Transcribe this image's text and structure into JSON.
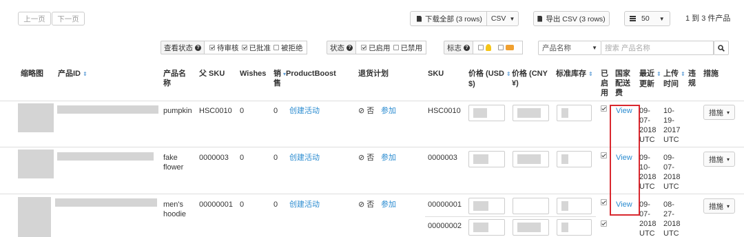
{
  "toolbar": {
    "prev_label": "上一页",
    "next_label": "下一页",
    "download_label": "下载全部 (3 rows)",
    "download_format": "CSV",
    "export_label": "导出 CSV (3 rows)",
    "page_size": "50",
    "range_text": "1 到 3 件产品"
  },
  "filters": {
    "review_status_label": "查看状态",
    "review_options": [
      {
        "label": "待审核",
        "checked": true
      },
      {
        "label": "已批准",
        "checked": true
      },
      {
        "label": "被拒绝",
        "checked": false
      }
    ],
    "status_label": "状态",
    "status_options": [
      {
        "label": "已启用",
        "checked": true
      },
      {
        "label": "已禁用",
        "checked": false
      }
    ],
    "tag_label": "标志",
    "search_field": "产品名称",
    "search_placeholder": "搜索 产品名称"
  },
  "table": {
    "headers": {
      "thumb": "缩略图",
      "product_id": "产品ID",
      "name_1": "产品名",
      "name_2": "称",
      "parent_sku": "父 SKU",
      "wishes": "Wishes",
      "sales_1": "销",
      "sales_2": "售",
      "productboost": "ProductBoost",
      "return_plan": "退货计划",
      "sku": "SKU",
      "price_usd_1": "价格 (USD",
      "price_usd_2": "$)",
      "price_cny_1": "价格 (CNY",
      "price_cny_2": "¥)",
      "inventory": "标准库存",
      "enabled_1": "已",
      "enabled_2": "启",
      "enabled_3": "用",
      "country_1": "国家",
      "country_2": "配送",
      "country_3": "费",
      "updated_1": "最近",
      "updated_2": "更新",
      "uploaded_1": "上传",
      "uploaded_2": "时间",
      "violation_1": "违",
      "violation_2": "规",
      "actions": "措施"
    },
    "rows": [
      {
        "name_1": "pumpkin",
        "name_2": "",
        "parent_sku": "HSC0010",
        "wishes": "0",
        "sales": "0",
        "boost": "创建活动",
        "return_no": "⊘ 否",
        "return_join": "参加",
        "skus": [
          "HSC0010"
        ],
        "view": "View",
        "updated": [
          "09-",
          "07-",
          "2018",
          "UTC"
        ],
        "uploaded": [
          "10-",
          "19-",
          "2017",
          "UTC"
        ],
        "action": "措施"
      },
      {
        "name_1": "fake",
        "name_2": "flower",
        "parent_sku": "0000003",
        "wishes": "0",
        "sales": "0",
        "boost": "创建活动",
        "return_no": "⊘ 否",
        "return_join": "参加",
        "skus": [
          "0000003"
        ],
        "view": "View",
        "updated": [
          "09-",
          "10-",
          "2018",
          "UTC"
        ],
        "uploaded": [
          "09-",
          "07-",
          "2018",
          "UTC"
        ],
        "action": "措施"
      },
      {
        "name_1": "men's",
        "name_2": "hoodie",
        "parent_sku": "00000001",
        "wishes": "0",
        "sales": "0",
        "boost": "创建活动",
        "return_no": "⊘ 否",
        "return_join": "参加",
        "skus": [
          "00000001",
          "00000002"
        ],
        "view": "View",
        "updated": [
          "09-",
          "07-",
          "2018",
          "UTC"
        ],
        "uploaded": [
          "08-",
          "27-",
          "2018",
          "UTC"
        ],
        "action": "措施"
      }
    ]
  },
  "colors": {
    "link": "#2a8bd0",
    "highlight_box": "#d9272e"
  }
}
